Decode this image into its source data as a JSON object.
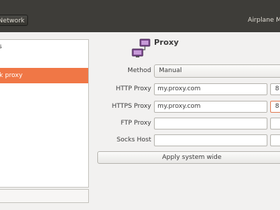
{
  "window": {
    "back_label": "Network",
    "airplane_label": "Airplane M"
  },
  "sidebar": {
    "top_item_label": "s",
    "selected_item_label": "k proxy"
  },
  "proxy": {
    "heading": "Proxy",
    "icon": "network-proxy-icon",
    "method": {
      "label": "Method",
      "value": "Manual"
    },
    "http": {
      "label": "HTTP Proxy",
      "host": "my.proxy.com",
      "port": "8"
    },
    "https": {
      "label": "HTTPS Proxy",
      "host": "my.proxy.com",
      "port": "8"
    },
    "ftp": {
      "label": "FTP Proxy",
      "host": "",
      "port": ""
    },
    "socks": {
      "label": "Socks Host",
      "host": "",
      "port": ""
    },
    "apply_label": "Apply system wide"
  },
  "colors": {
    "titlebar": "#3e3d39",
    "selection": "#f07746",
    "focus_border": "#e07a52"
  }
}
